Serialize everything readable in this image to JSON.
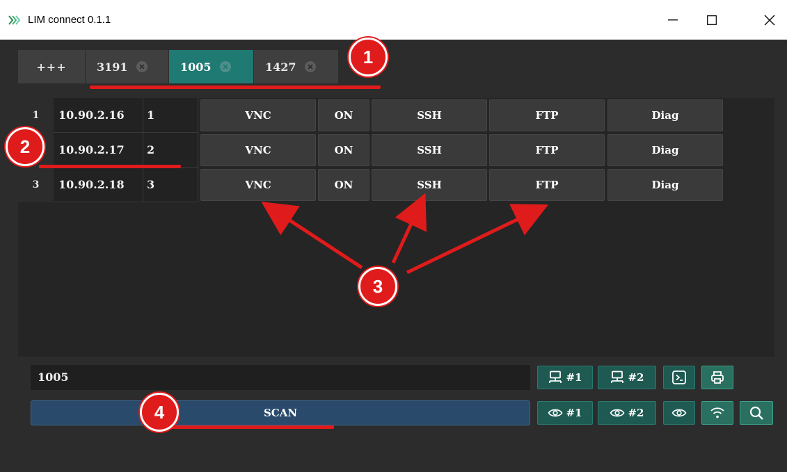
{
  "window": {
    "title": "LIM connect 0.1.1",
    "controls": {
      "minimize": "—",
      "maximize": "☐",
      "close": "✕"
    }
  },
  "tabs": [
    {
      "label": "+++",
      "active": false,
      "closable": false
    },
    {
      "label": "3191",
      "active": false,
      "closable": true
    },
    {
      "label": "1005",
      "active": true,
      "closable": true
    },
    {
      "label": "1427",
      "active": false,
      "closable": true
    }
  ],
  "devices": [
    {
      "row": "1",
      "ip": "10.90.2.16",
      "num": "1",
      "vnc": "VNC",
      "on": "ON",
      "ssh": "SSH",
      "ftp": "FTP",
      "diag": "Diag"
    },
    {
      "row": "2",
      "ip": "10.90.2.17",
      "num": "2",
      "vnc": "VNC",
      "on": "ON",
      "ssh": "SSH",
      "ftp": "FTP",
      "diag": "Diag"
    },
    {
      "row": "3",
      "ip": "10.90.2.18",
      "num": "3",
      "vnc": "VNC",
      "on": "ON",
      "ssh": "SSH",
      "ftp": "FTP",
      "diag": "Diag"
    }
  ],
  "input": {
    "value": "1005"
  },
  "scan": {
    "label": "SCAN"
  },
  "tools_row1": [
    {
      "icon": "network-icon",
      "label": "#1"
    },
    {
      "icon": "network-icon",
      "label": "#2"
    },
    {
      "icon": "terminal-icon",
      "label": ""
    },
    {
      "icon": "printer-icon",
      "label": ""
    }
  ],
  "tools_row2": [
    {
      "icon": "eye-icon",
      "label": "#1"
    },
    {
      "icon": "eye-icon",
      "label": "#2"
    },
    {
      "icon": "eye-icon",
      "label": ""
    },
    {
      "icon": "wifi-icon",
      "label": ""
    },
    {
      "icon": "search-icon",
      "label": ""
    }
  ],
  "annotations": {
    "badge1": "1",
    "badge2": "2",
    "badge3": "3",
    "badge4": "4"
  },
  "colors": {
    "accent": "#1f7a73",
    "annotation": "#e01b1b",
    "scan": "#2a4a6b"
  }
}
